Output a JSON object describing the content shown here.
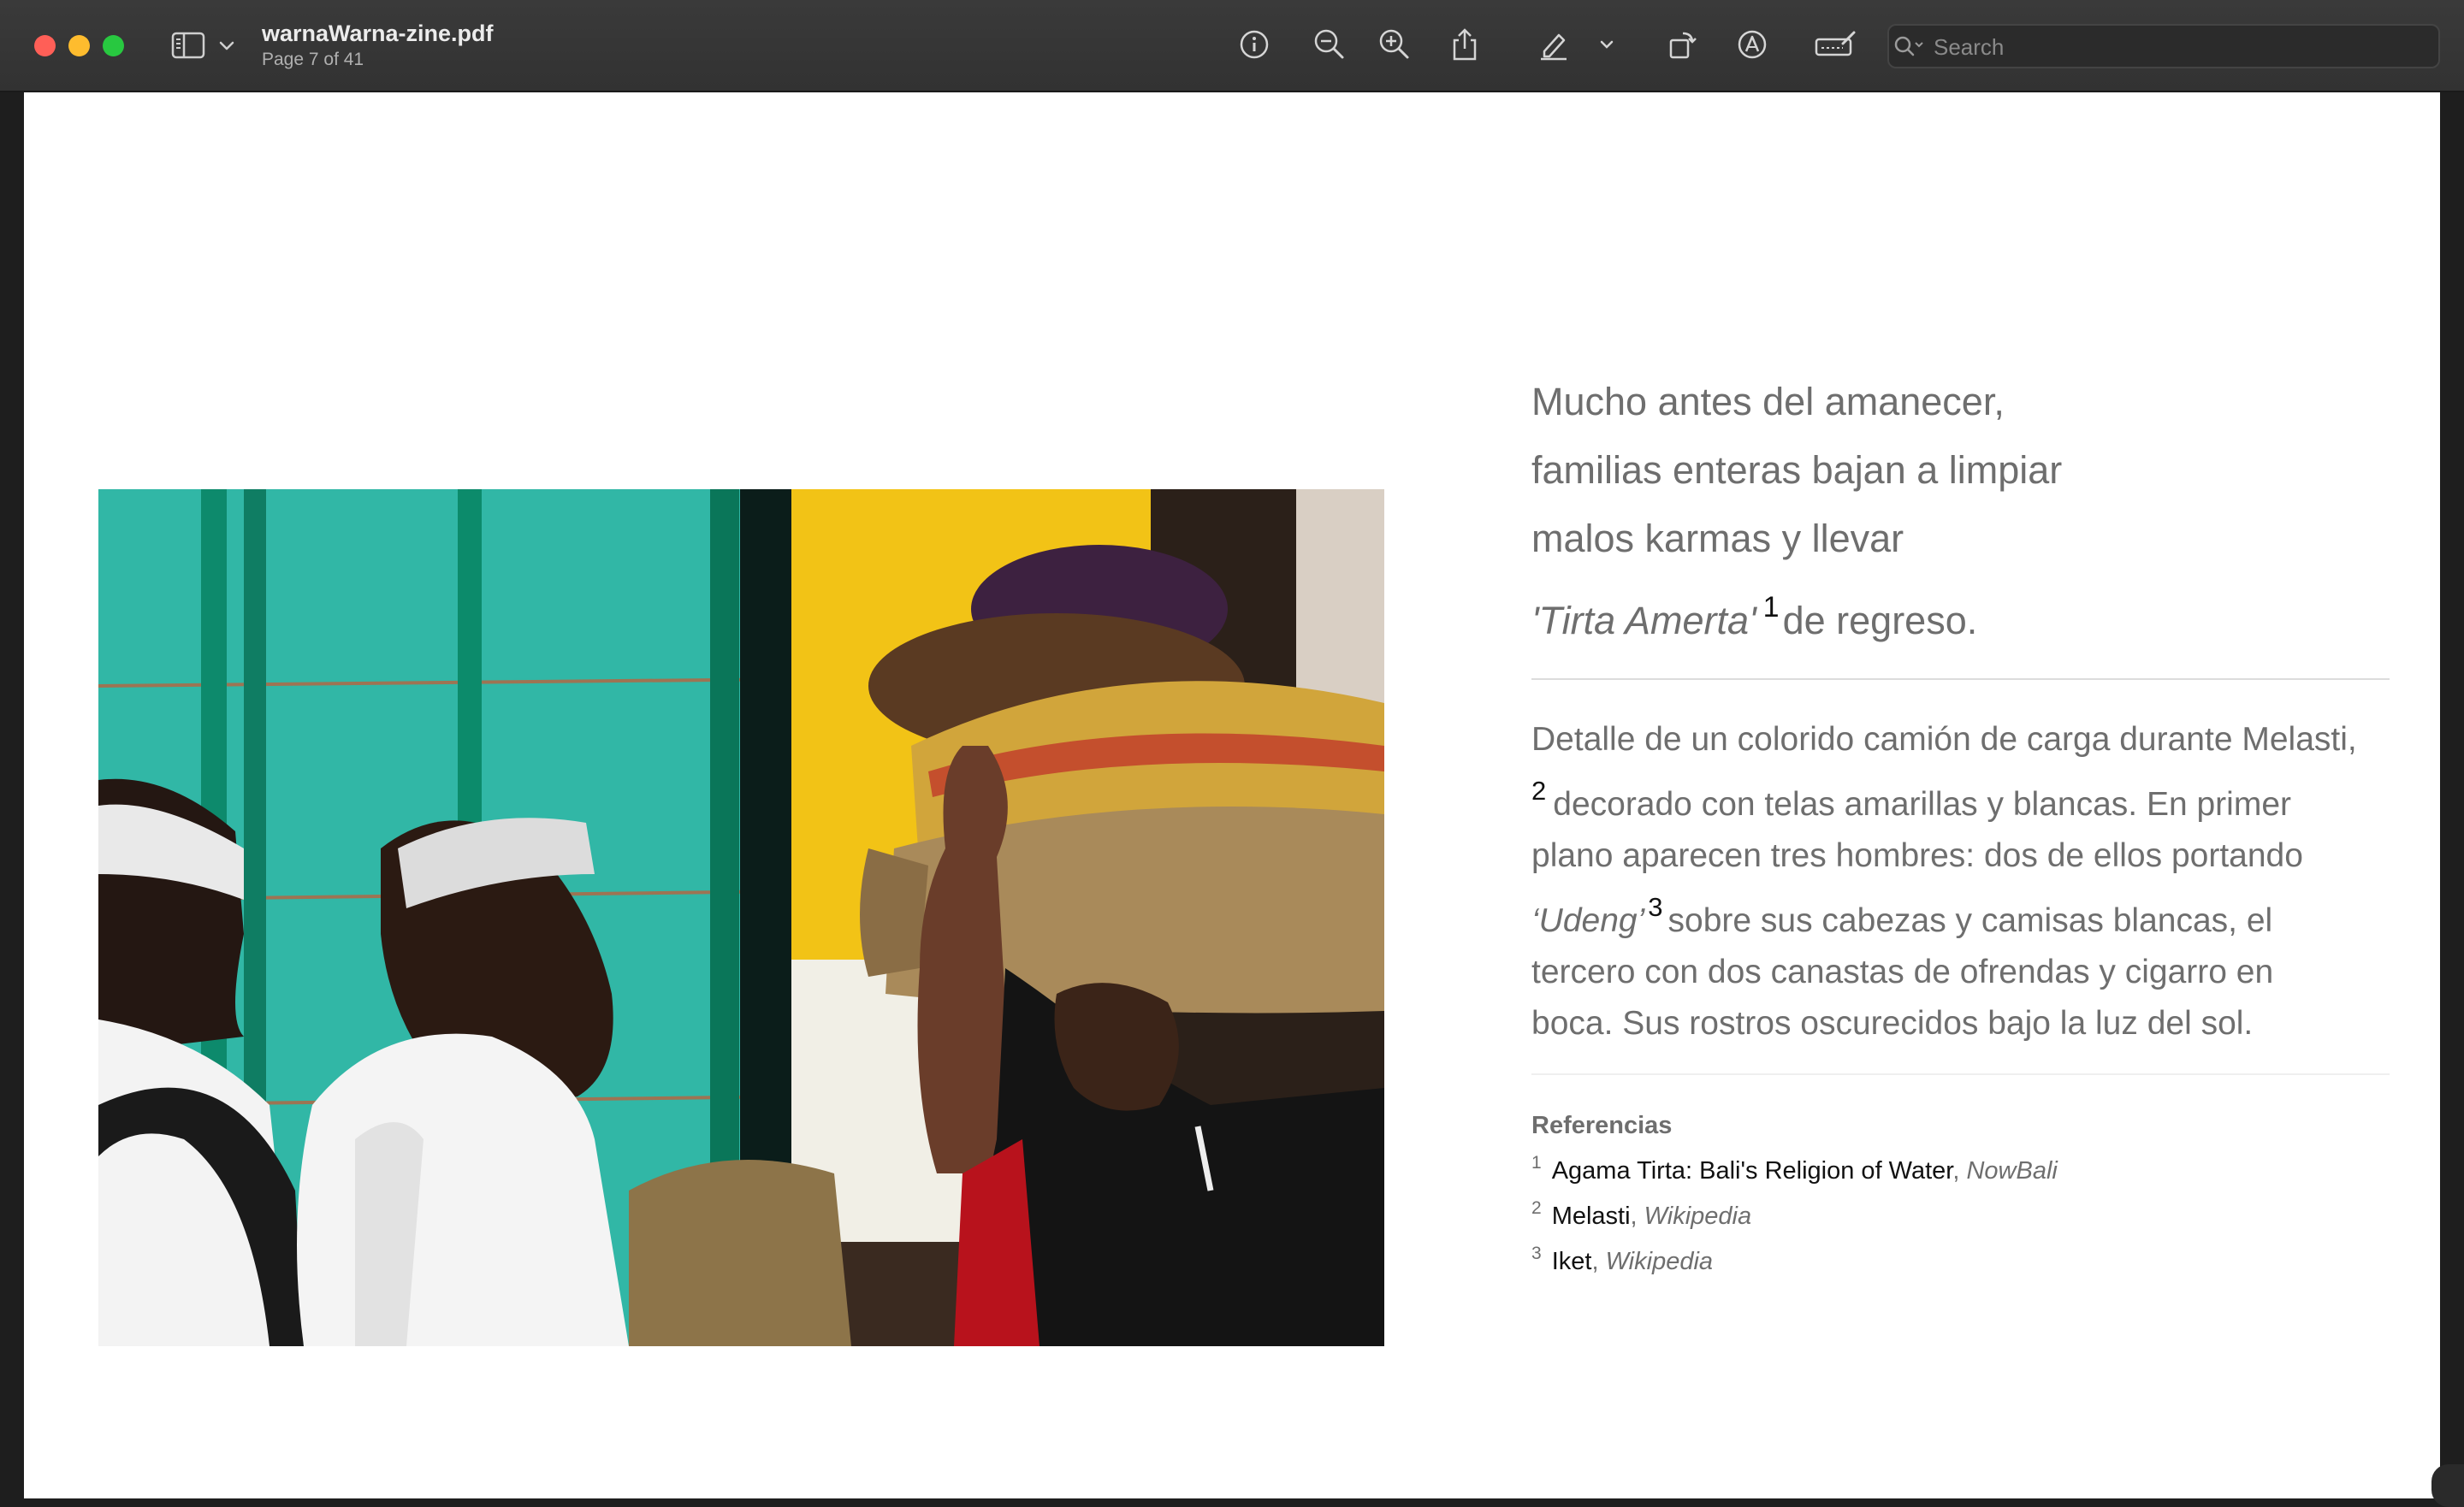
{
  "window": {
    "file_name": "warnaWarna-zine.pdf",
    "page_indicator": "Page 7 of 41"
  },
  "toolbar": {
    "buttons": [
      "info-icon",
      "zoom-out-icon",
      "zoom-in-icon",
      "share-icon",
      "highlight-pen-icon",
      "chevron-down-icon",
      "rotate-icon",
      "markup-icon",
      "signature-icon"
    ],
    "search_placeholder": "Search"
  },
  "page": {
    "photo_description_icon": "photo",
    "poem": {
      "line1": "Mucho antes del amanecer,",
      "line2": "familias enteras bajan a limpiar",
      "line3": "malos karmas y llevar",
      "line4_term": "'Tirta Amerta'",
      "line4_ref": "1",
      "line4_rest": "de regreso."
    },
    "caption": {
      "line1": "Detalle de un colorido camión de carga durante Melasti,",
      "line2_ref": "2",
      "line2_rest": "decorado con telas amarillas y blancas. En primer",
      "line3": "plano aparecen tres hombres: dos de ellos portando",
      "line4_term": "‘Udeng’",
      "line4_ref": "3",
      "line4_rest": "sobre sus cabezas y camisas blancas, el",
      "line5": "tercero con dos canastas de ofrendas y cigarro en",
      "line6": "boca. Sus rostros oscurecidos bajo la luz del sol."
    },
    "references": {
      "title": "Referencias",
      "items": [
        {
          "num": "1",
          "title": "Agama Tirta: Bali's Religion of Water",
          "sep": ",",
          "source": "NowBali"
        },
        {
          "num": "2",
          "title": "Melasti",
          "sep": ",",
          "source": "Wikipedia"
        },
        {
          "num": "3",
          "title": "Iket",
          "sep": ",",
          "source": "Wikipedia"
        }
      ]
    }
  },
  "colors": {
    "close": "#ff5f57",
    "minimize": "#febc2e",
    "maximize": "#28c840",
    "toolbar_bg": "#353535",
    "text_gray": "#6e6e6e"
  }
}
